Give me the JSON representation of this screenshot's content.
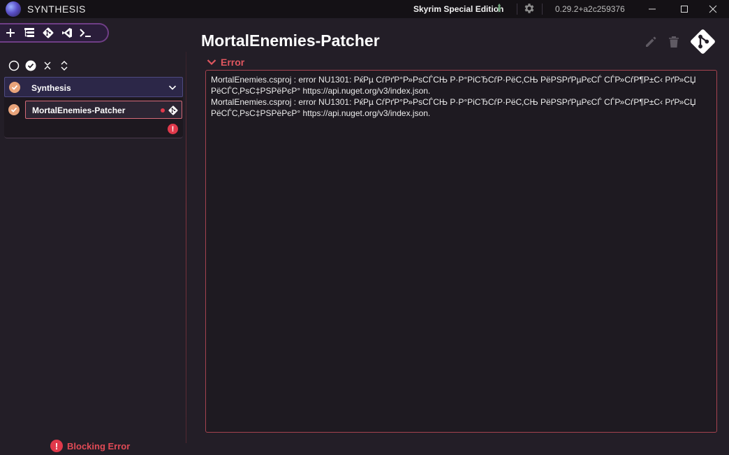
{
  "window": {
    "app_title": "SYNTHESIS",
    "game_name": "Skyrim Special Edition",
    "version": "0.29.2+a2c259376",
    "controls": [
      "minimize-icon",
      "maximize-icon",
      "close-icon"
    ]
  },
  "toolbar": {
    "buttons": [
      "plus-icon",
      "list-tree-icon",
      "git-icon",
      "visual-studio-icon",
      "terminal-icon"
    ]
  },
  "select_controls": [
    "select-none-icon",
    "select-all-icon",
    "collapse-icon",
    "expand-icon"
  ],
  "sidebar": {
    "group": {
      "name": "Synthesis",
      "status": "enabled",
      "patchers": [
        {
          "name": "MortalEnemies-Patcher",
          "status": "enabled",
          "has_error": true
        }
      ],
      "error_badge": "!"
    },
    "blocking_error": {
      "icon": "!",
      "label": "Blocking Error"
    }
  },
  "main": {
    "title": "MortalEnemies-Patcher",
    "error_section": {
      "label": "Error",
      "lines": [
        "MortalEnemies.csproj : error NU1301: РќРµ СѓРґР°Р»РѕСЃСЊ Р·Р°РіСЂСѓР·РёС‚СЊ РёРЅРґРµРєСЃ СЃР»СѓР¶Р±С‹ РґР»СЏ РёСЃС‚РѕС‡РЅРёРєР° https://api.nuget.org/v3/index.json.",
        "MortalEnemies.csproj : error NU1301: РќРµ СѓРґР°Р»РѕСЃСЊ Р·Р°РіСЂСѓР·РёС‚СЊ РёРЅРґРµРєСЃ СЃР»СѓР¶Р±С‹ РґР»СЏ РёСЃС‚РѕС‡РЅРёРєР° https://api.nuget.org/v3/index.json."
      ]
    }
  },
  "colors": {
    "background": "#231e27",
    "titlebar": "#141115",
    "accent_red": "#e0394b",
    "status_orange": "#e8a37a",
    "group_header": "#2c2748"
  }
}
